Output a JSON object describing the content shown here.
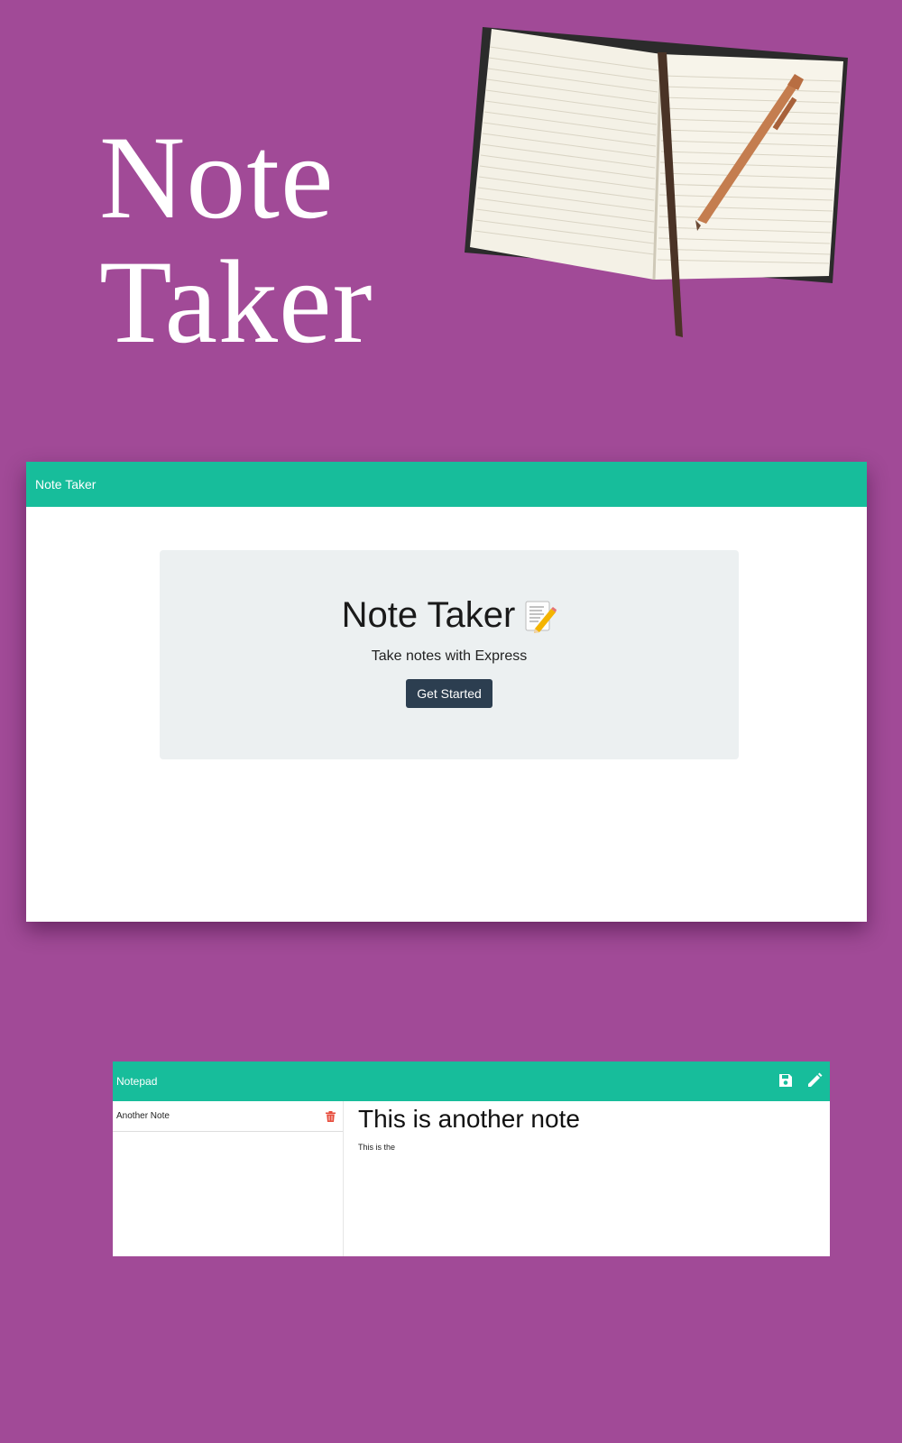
{
  "hero": {
    "title_line1": "Note",
    "title_line2": "Taker"
  },
  "landing": {
    "brand": "Note Taker",
    "heading": "Note Taker",
    "lead": "Take notes with Express",
    "button_label": "Get Started",
    "heading_icon": "memo-icon"
  },
  "notepad": {
    "brand": "Notepad",
    "nav_icons": [
      "save-icon",
      "pencil-icon"
    ],
    "notes": [
      {
        "title": "Another Note"
      }
    ],
    "active_note": {
      "title": "This is another note",
      "text": "This is the"
    }
  },
  "colors": {
    "background": "#a14a97",
    "navbar": "#17bd9b",
    "jumbotron": "#ecf0f1",
    "button": "#2c3e50",
    "trash": "#e74c3c"
  }
}
